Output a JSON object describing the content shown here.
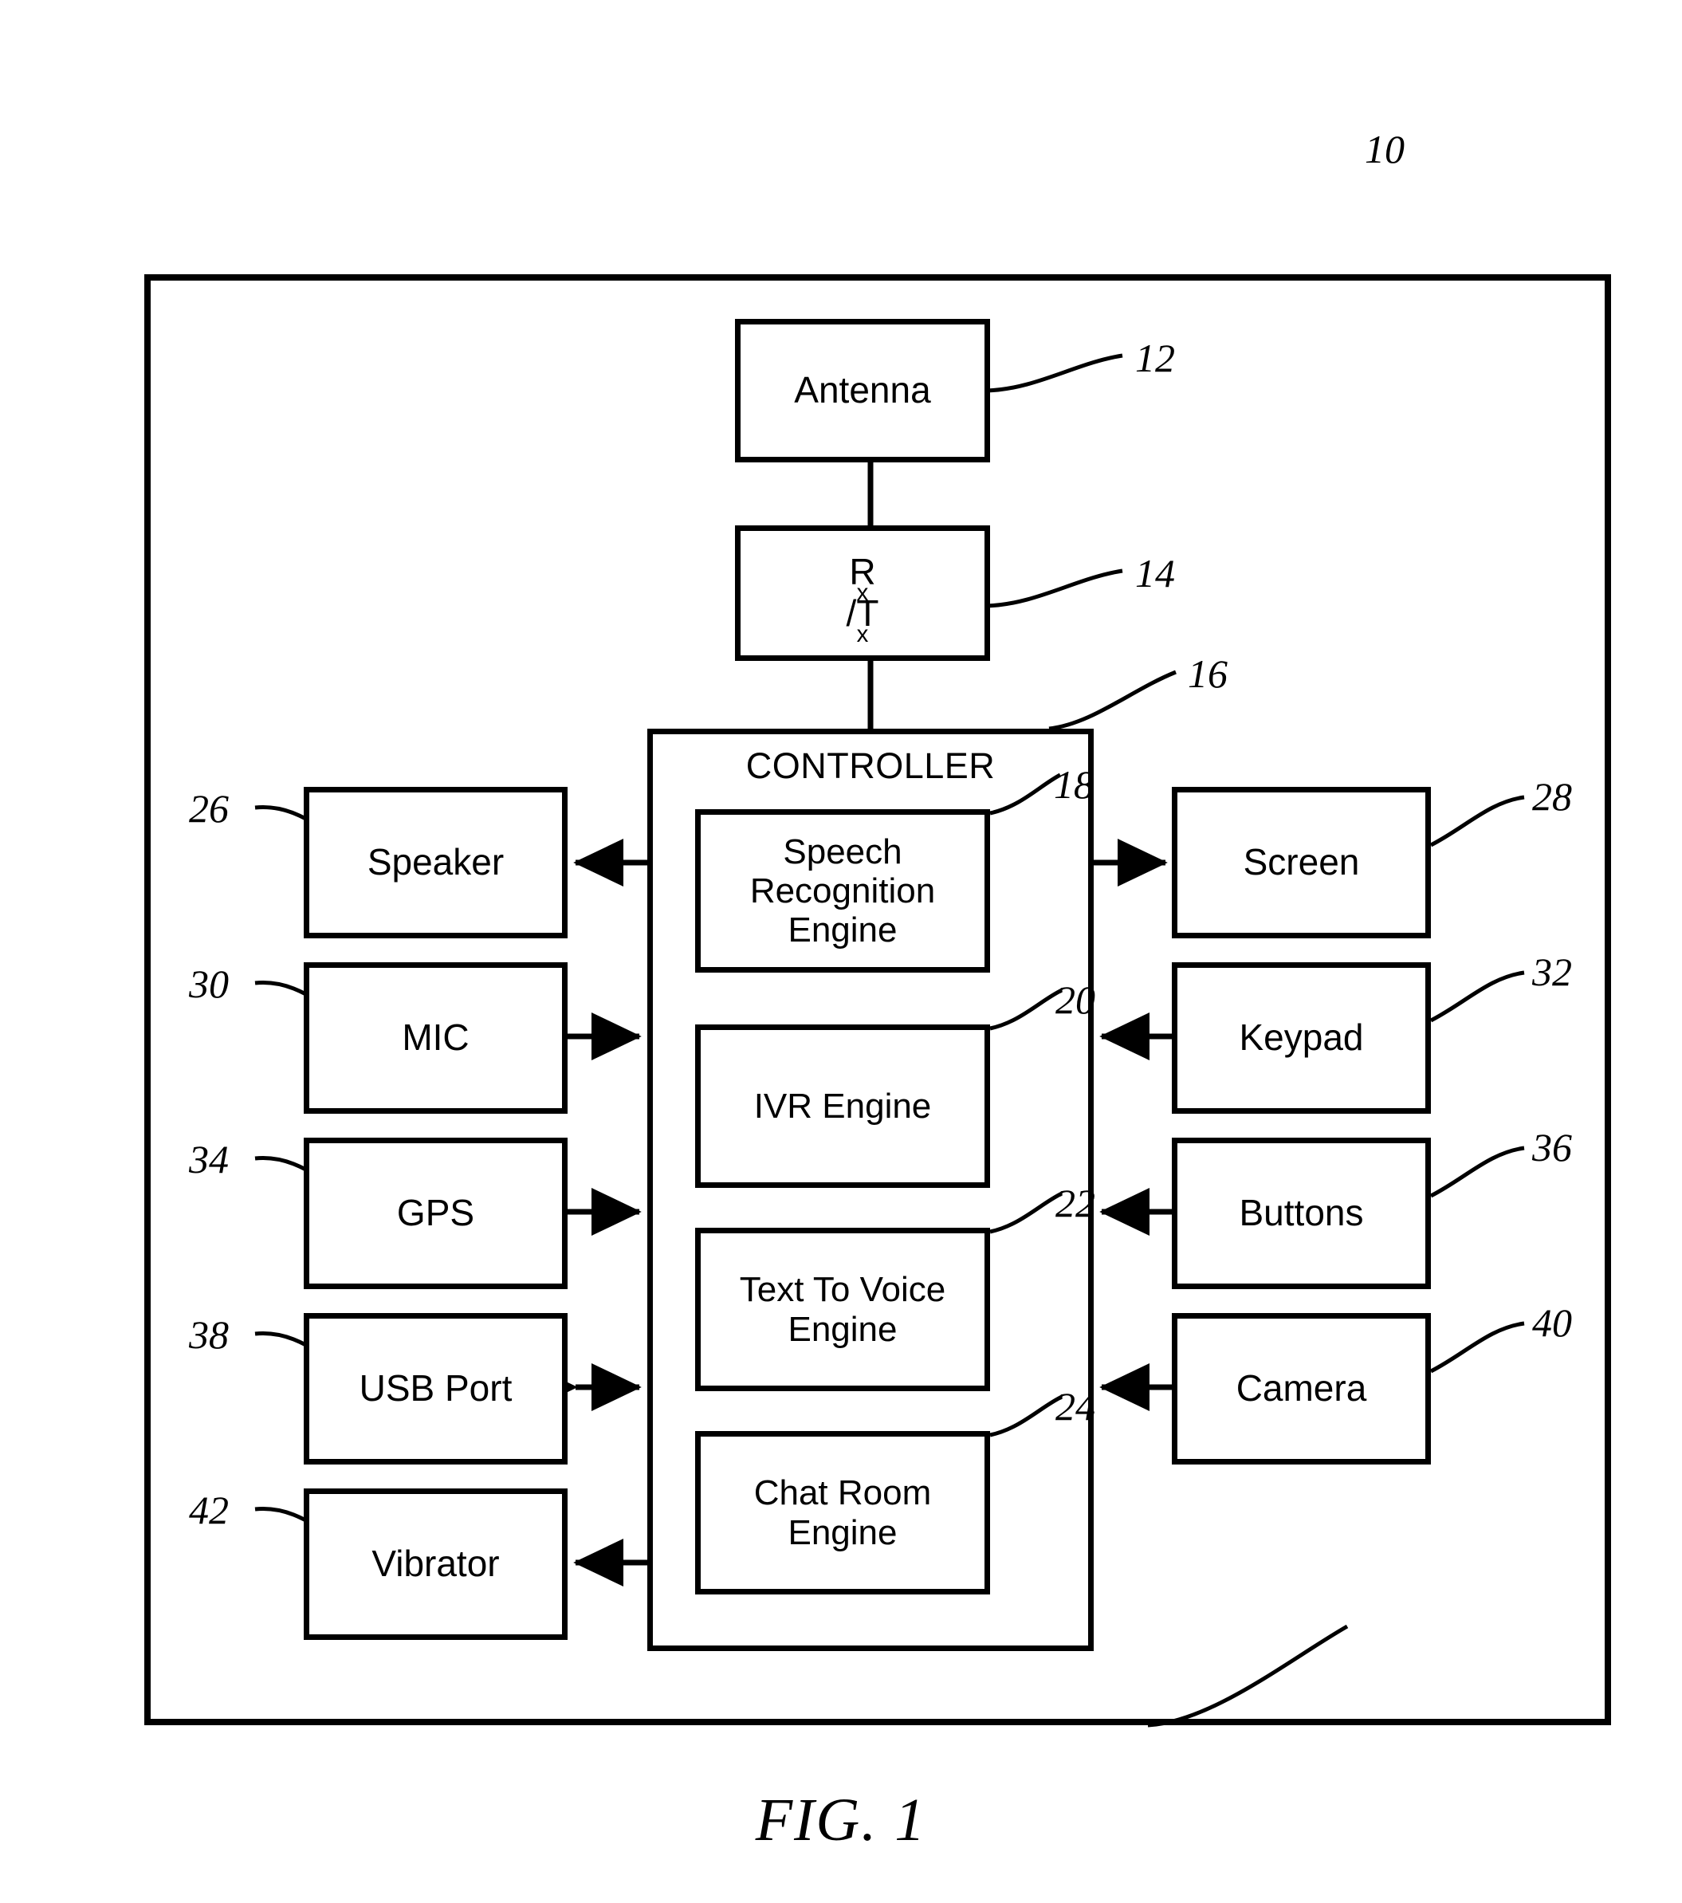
{
  "figure": {
    "caption": "FIG. 1",
    "system_ref": "10"
  },
  "controller": {
    "title": "CONTROLLER",
    "ref": "16",
    "engines": [
      {
        "label": "Speech Recognition Engine",
        "lines": [
          "Speech",
          "Recognition",
          "Engine"
        ],
        "ref": "18"
      },
      {
        "label": "IVR Engine",
        "lines": [
          "IVR Engine"
        ],
        "ref": "20"
      },
      {
        "label": "Text To Voice Engine",
        "lines": [
          "Text To Voice",
          "Engine"
        ],
        "ref": "22"
      },
      {
        "label": "Chat Room Engine",
        "lines": [
          "Chat Room",
          "Engine"
        ],
        "ref": "24"
      }
    ]
  },
  "radio": {
    "antenna": {
      "label": "Antenna",
      "ref": "12"
    },
    "transceiver": {
      "label_main": "R",
      "label_sub1": "x",
      "label_mid": "/T",
      "label_sub2": "x",
      "label": "Rx/Tx",
      "ref": "14"
    }
  },
  "peripherals_left": [
    {
      "label": "Speaker",
      "ref": "26",
      "direction": "output"
    },
    {
      "label": "MIC",
      "ref": "30",
      "direction": "input"
    },
    {
      "label": "GPS",
      "ref": "34",
      "direction": "input"
    },
    {
      "label": "USB Port",
      "ref": "38",
      "direction": "bidirectional"
    },
    {
      "label": "Vibrator",
      "ref": "42",
      "direction": "output"
    }
  ],
  "peripherals_right": [
    {
      "label": "Screen",
      "ref": "28",
      "direction": "output"
    },
    {
      "label": "Keypad",
      "ref": "32",
      "direction": "input"
    },
    {
      "label": "Buttons",
      "ref": "36",
      "direction": "input"
    },
    {
      "label": "Camera",
      "ref": "40",
      "direction": "input"
    }
  ],
  "colors": {
    "ink": "#000000",
    "paper": "#ffffff"
  },
  "chart_data": {
    "type": "diagram",
    "title": "FIG. 1",
    "nodes": [
      {
        "id": "10",
        "label": "system",
        "role": "enclosure"
      },
      {
        "id": "12",
        "label": "Antenna",
        "role": "block"
      },
      {
        "id": "14",
        "label": "Rx/Tx",
        "role": "block"
      },
      {
        "id": "16",
        "label": "CONTROLLER",
        "role": "enclosure"
      },
      {
        "id": "18",
        "label": "Speech Recognition Engine",
        "role": "block"
      },
      {
        "id": "20",
        "label": "IVR Engine",
        "role": "block"
      },
      {
        "id": "22",
        "label": "Text To Voice Engine",
        "role": "block"
      },
      {
        "id": "24",
        "label": "Chat Room Engine",
        "role": "block"
      },
      {
        "id": "26",
        "label": "Speaker",
        "role": "block"
      },
      {
        "id": "28",
        "label": "Screen",
        "role": "block"
      },
      {
        "id": "30",
        "label": "MIC",
        "role": "block"
      },
      {
        "id": "32",
        "label": "Keypad",
        "role": "block"
      },
      {
        "id": "34",
        "label": "GPS",
        "role": "block"
      },
      {
        "id": "36",
        "label": "Buttons",
        "role": "block"
      },
      {
        "id": "38",
        "label": "USB Port",
        "role": "block"
      },
      {
        "id": "40",
        "label": "Camera",
        "role": "block"
      },
      {
        "id": "42",
        "label": "Vibrator",
        "role": "block"
      }
    ],
    "edges": [
      {
        "from": "12",
        "to": "14",
        "arrow": "none"
      },
      {
        "from": "14",
        "to": "16",
        "arrow": "none"
      },
      {
        "from": "16",
        "to": "26",
        "arrow": "single"
      },
      {
        "from": "30",
        "to": "16",
        "arrow": "single"
      },
      {
        "from": "34",
        "to": "16",
        "arrow": "single"
      },
      {
        "from": "38",
        "to": "16",
        "arrow": "double"
      },
      {
        "from": "16",
        "to": "42",
        "arrow": "single"
      },
      {
        "from": "16",
        "to": "28",
        "arrow": "single"
      },
      {
        "from": "32",
        "to": "16",
        "arrow": "single"
      },
      {
        "from": "36",
        "to": "16",
        "arrow": "single"
      },
      {
        "from": "40",
        "to": "16",
        "arrow": "single"
      }
    ]
  }
}
